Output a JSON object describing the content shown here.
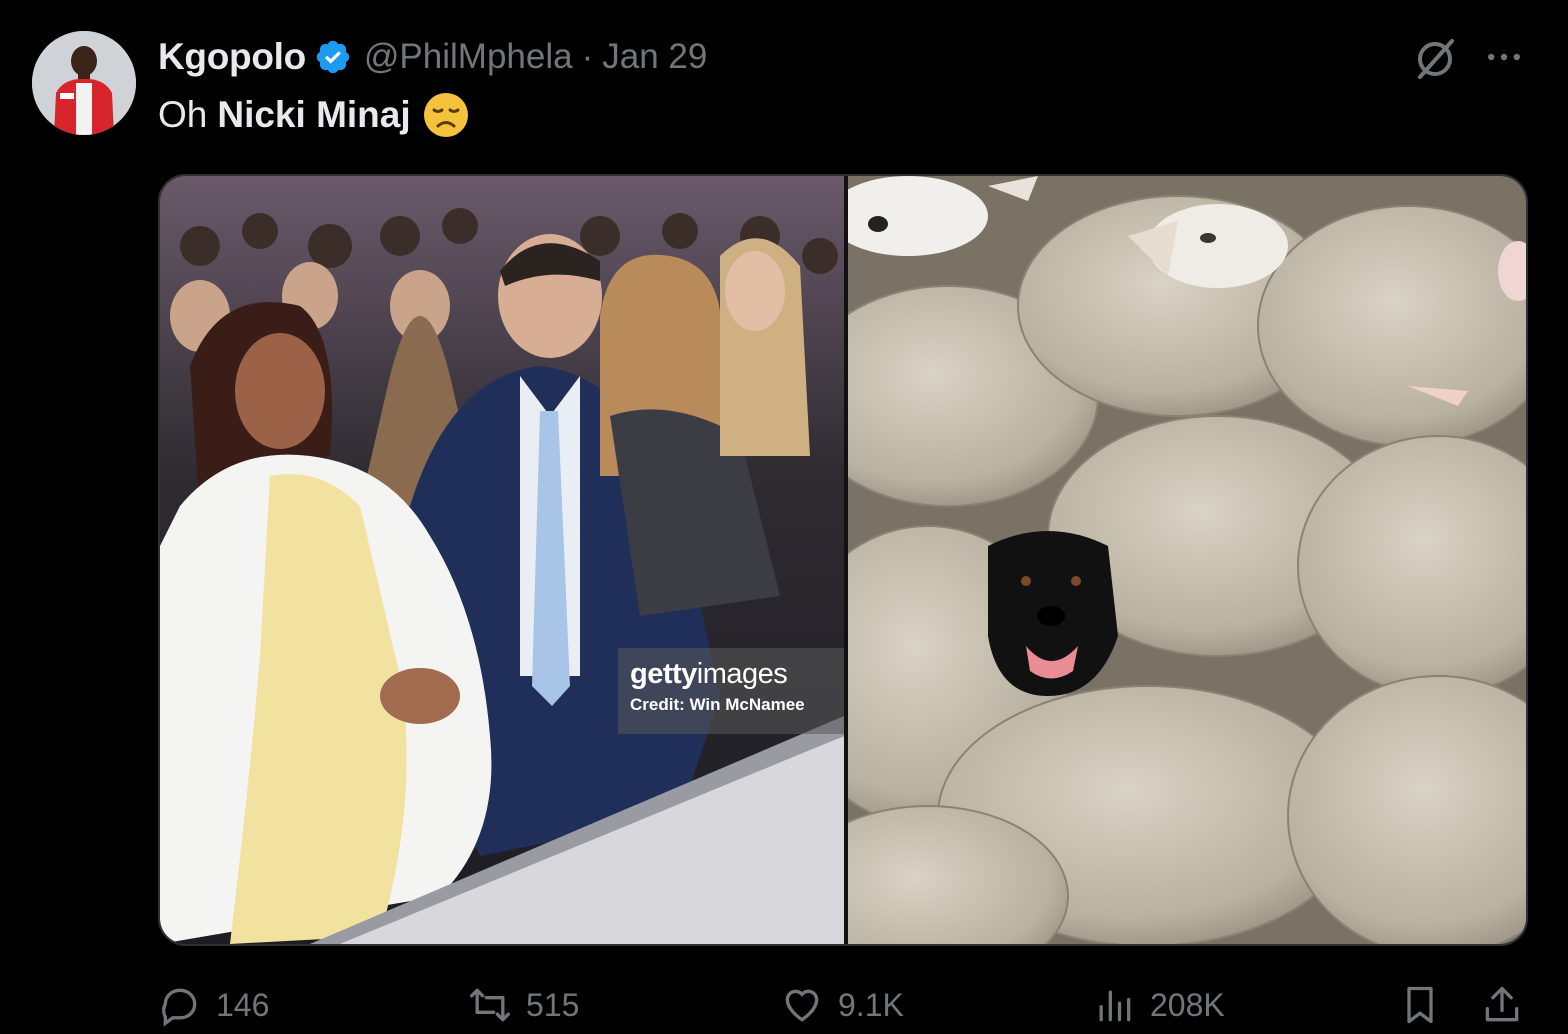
{
  "tweet": {
    "author_name": "Kgopolo",
    "handle": "@PhilMphela",
    "separator": "·",
    "date": "Jan 29",
    "text_prefix": "Oh",
    "text_bold": "Nicki Minaj",
    "emoji": "disappointed-face"
  },
  "media": {
    "left_watermark_brand_bold": "getty",
    "left_watermark_brand": "images",
    "left_watermark_credit": "Credit: Win McNamee"
  },
  "actions": {
    "replies": "146",
    "reposts": "515",
    "likes": "9.1K",
    "views": "208K"
  },
  "colors": {
    "background": "#000000",
    "text_primary": "#e7e9ea",
    "text_secondary": "#71767b",
    "verified": "#1d9bf0"
  }
}
